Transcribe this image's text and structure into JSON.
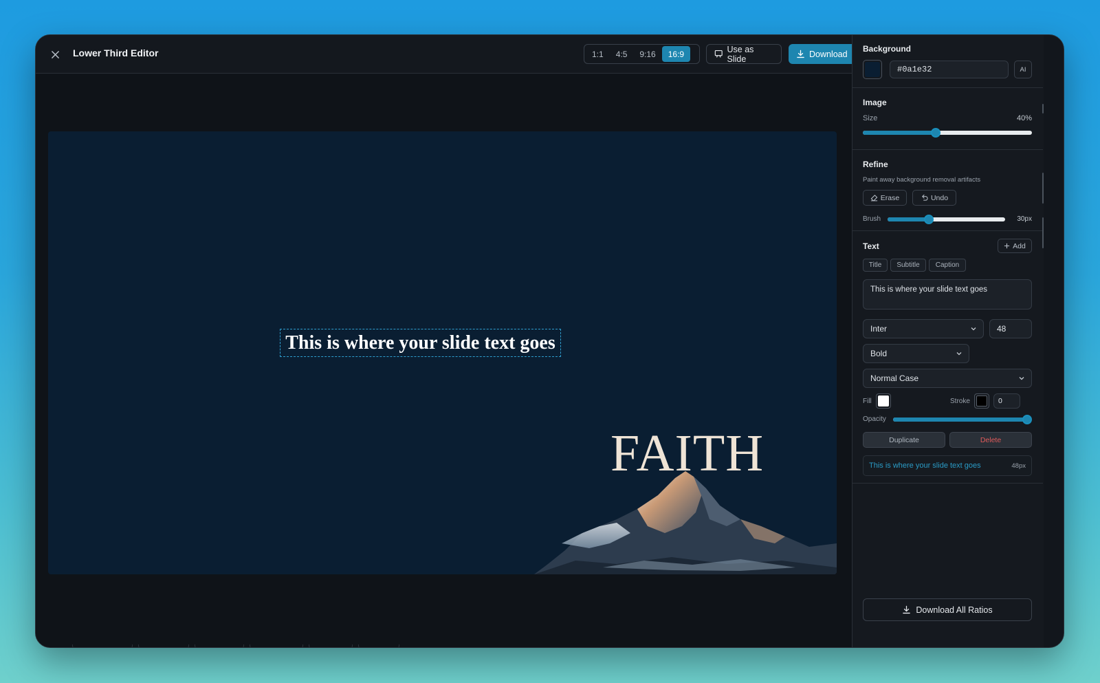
{
  "app": {
    "title": "Lower Third Editor"
  },
  "header": {
    "ratios": [
      "1:1",
      "4:5",
      "9:16",
      "16:9"
    ],
    "active_ratio": "16:9",
    "use_as_slide_label": "Use as Slide",
    "download_label": "Download"
  },
  "canvas": {
    "background_color": "#0a1e32",
    "slide_text": "This is where your slide text goes",
    "image_word": "FAITH"
  },
  "panel": {
    "background": {
      "title": "Background",
      "color_value": "#0a1e32",
      "ai_label": "AI"
    },
    "image": {
      "title": "Image",
      "size_label": "Size",
      "size_value": "40%",
      "size_fraction": 0.43
    },
    "refine": {
      "title": "Refine",
      "description": "Paint away background removal artifacts",
      "erase_label": "Erase",
      "undo_label": "Undo",
      "brush_label": "Brush",
      "brush_value": "30px",
      "brush_fraction": 0.35
    },
    "text": {
      "title": "Text",
      "add_label": "Add",
      "presets": [
        "Title",
        "Subtitle",
        "Caption"
      ],
      "content": "This is where your slide text goes",
      "font": "Inter",
      "font_size": "48",
      "weight": "Bold",
      "case": "Normal Case",
      "fill_label": "Fill",
      "fill_color": "#ffffff",
      "stroke_label": "Stroke",
      "stroke_color": "#000000",
      "stroke_width": "0",
      "opacity_label": "Opacity",
      "opacity_fraction": 1.0,
      "duplicate_label": "Duplicate",
      "delete_label": "Delete",
      "layer_text": "This is where your slide text goes",
      "layer_size": "48px"
    },
    "download_all_label": "Download All Ratios"
  },
  "colors": {
    "accent": "#1e86b0",
    "delete": "#e05a5a",
    "layer_text": "#2a9bc6"
  }
}
